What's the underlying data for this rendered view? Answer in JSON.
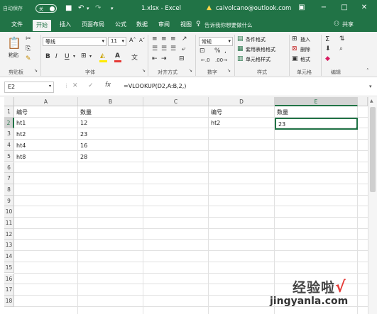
{
  "titlebar": {
    "autosave_label": "自动保存",
    "autosave_state": "关",
    "file_title": "1.xlsx - Excel",
    "account": "caivolcano@outlook.com"
  },
  "tabs": [
    "文件",
    "开始",
    "插入",
    "页面布局",
    "公式",
    "数据",
    "审阅",
    "视图"
  ],
  "active_tab": "开始",
  "tell_me": "告诉我你想要做什么",
  "share_label": "共享",
  "ribbon": {
    "clipboard": {
      "paste": "粘贴",
      "label": "剪贴板"
    },
    "font": {
      "name": "等线",
      "size": "11",
      "bold": "B",
      "italic": "I",
      "underline": "U",
      "label": "字体",
      "grow": "A",
      "shrink": "A"
    },
    "alignment": {
      "label": "对齐方式"
    },
    "number": {
      "format": "常规",
      "label": "数字",
      "percent": "%",
      "comma": ","
    },
    "styles": {
      "conditional": "条件格式",
      "table": "套用表格格式",
      "cell": "单元格样式",
      "label": "样式"
    },
    "cells": {
      "insert": "插入",
      "delete": "删除",
      "format": "格式",
      "label": "单元格"
    },
    "editing": {
      "sum": "Σ",
      "label": "编辑"
    }
  },
  "formula_bar": {
    "name_box": "E2",
    "fx": "fx",
    "formula": "=VLOOKUP(D2,A:B,2,)"
  },
  "sheet": {
    "columns": [
      "A",
      "B",
      "C",
      "D",
      "E"
    ],
    "rows": [
      "1",
      "2",
      "3",
      "4",
      "5",
      "6",
      "7",
      "8",
      "9",
      "10",
      "11",
      "12",
      "13",
      "14",
      "15",
      "16",
      "17",
      "18"
    ],
    "cells": {
      "A1": "编号",
      "B1": "数量",
      "D1": "编号",
      "E1": "数量",
      "A2": "ht1",
      "B2": "12",
      "D2": "ht2",
      "E2": "23",
      "A3": "ht2",
      "B3": "23",
      "A4": "ht4",
      "B4": "16",
      "A5": "ht8",
      "B5": "28"
    }
  },
  "watermark": {
    "text": "经验啦",
    "check": "√",
    "url": "jingyanla.com"
  },
  "colors": {
    "accent": "#217346",
    "selection_header": "#d3d3d3"
  }
}
